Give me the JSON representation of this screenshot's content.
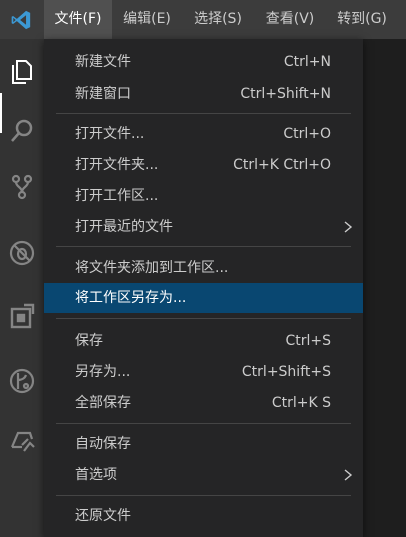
{
  "colors": {
    "menubar_bg": "#3c3c3c",
    "activitybar_bg": "#333333",
    "dropdown_bg": "#252526",
    "selected_bg": "#094771",
    "logo_blue": "#3c99d4"
  },
  "menubar": {
    "items": [
      {
        "label": "文件(F)"
      },
      {
        "label": "编辑(E)"
      },
      {
        "label": "选择(S)"
      },
      {
        "label": "查看(V)"
      },
      {
        "label": "转到(G)"
      }
    ]
  },
  "activitybar": {
    "icons": [
      "explorer-icon",
      "search-icon",
      "source-control-icon",
      "debug-icon",
      "extensions-icon",
      "timeline-icon",
      "remote-explorer-icon"
    ]
  },
  "file_menu": {
    "items": [
      {
        "label": "新建文件",
        "keys": "Ctrl+N"
      },
      {
        "label": "新建窗口",
        "keys": "Ctrl+Shift+N"
      },
      {
        "label": "打开文件...",
        "keys": "Ctrl+O"
      },
      {
        "label": "打开文件夹...",
        "keys": "Ctrl+K Ctrl+O"
      },
      {
        "label": "打开工作区...",
        "keys": ""
      },
      {
        "label": "打开最近的文件",
        "keys": ""
      },
      {
        "label": "将文件夹添加到工作区...",
        "keys": ""
      },
      {
        "label": "将工作区另存为...",
        "keys": ""
      },
      {
        "label": "保存",
        "keys": "Ctrl+S"
      },
      {
        "label": "另存为...",
        "keys": "Ctrl+Shift+S"
      },
      {
        "label": "全部保存",
        "keys": "Ctrl+K S"
      },
      {
        "label": "自动保存",
        "keys": ""
      },
      {
        "label": "首选项",
        "keys": ""
      },
      {
        "label": "还原文件",
        "keys": ""
      }
    ]
  }
}
